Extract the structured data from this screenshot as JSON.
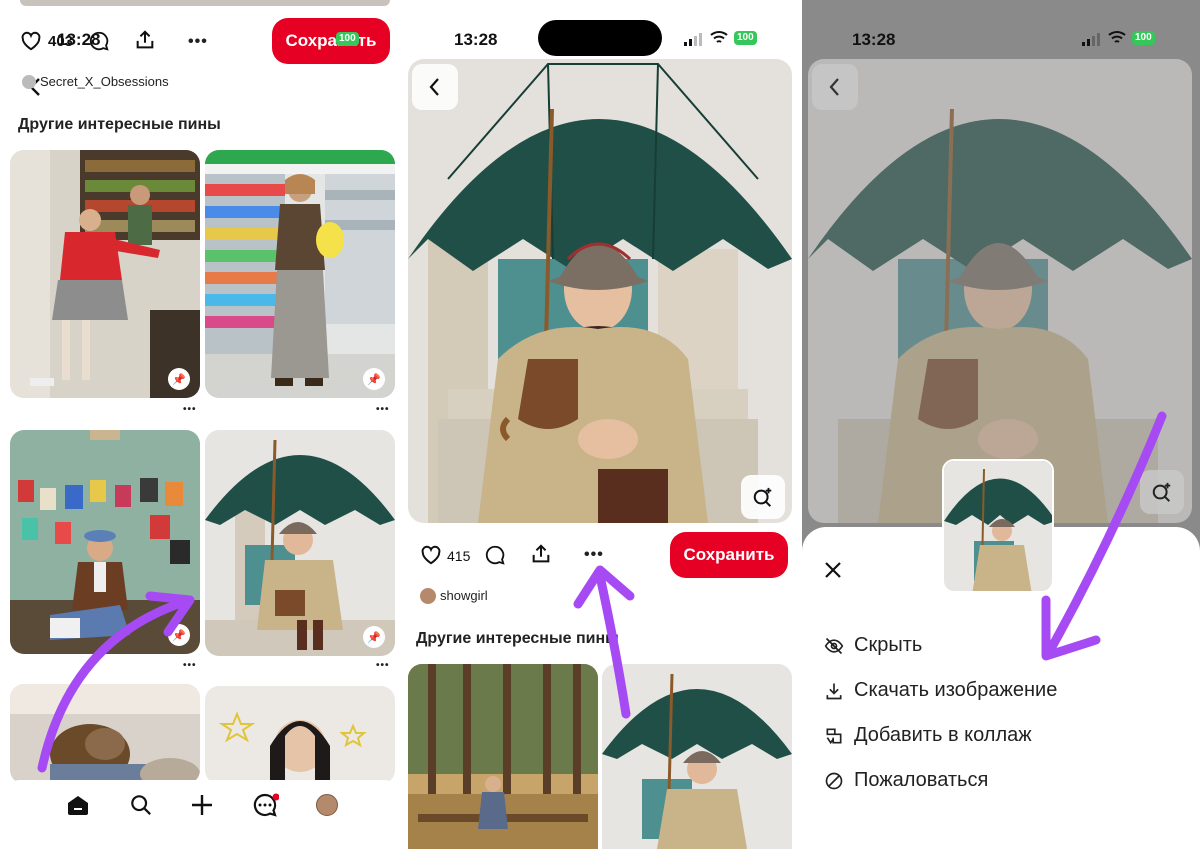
{
  "panel1": {
    "time": "13:28",
    "battery": "100",
    "likes": "403",
    "save_label": "Сохранить",
    "author": "Secret_X_Obsessions",
    "section_title": "Другие интересные пины",
    "dots": "•••"
  },
  "panel2": {
    "time": "13:28",
    "battery": "100",
    "likes": "415",
    "save_label": "Сохранить",
    "author": "showgirl",
    "section_title": "Другие интересные пины"
  },
  "panel3": {
    "time": "13:28",
    "battery": "100",
    "menu": [
      {
        "label": "Скрыть",
        "icon": "hide-icon"
      },
      {
        "label": "Скачать изображение",
        "icon": "download-icon"
      },
      {
        "label": "Добавить в коллаж",
        "icon": "collage-icon"
      },
      {
        "label": "Пожаловаться",
        "icon": "report-icon"
      }
    ]
  },
  "colors": {
    "brand_red": "#e60023",
    "arrow_purple": "#a64bf4",
    "umbrella_green": "#1f4f47",
    "coat_beige": "#c9b48a"
  }
}
